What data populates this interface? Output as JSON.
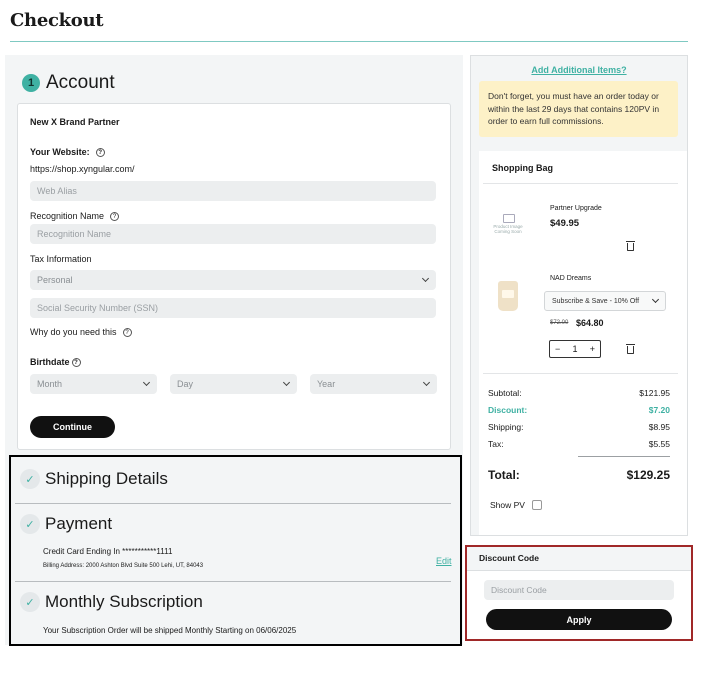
{
  "page": {
    "title": "Checkout"
  },
  "account": {
    "step_number": "1",
    "title": "Account",
    "partner_type": "New X Brand Partner",
    "website_label": "Your Website:",
    "website_prefix": "https://shop.xyngular.com/",
    "web_alias_placeholder": "Web Alias",
    "recognition_label": "Recognition Name",
    "recognition_placeholder": "Recognition Name",
    "tax_label": "Tax Information",
    "tax_selected": "Personal",
    "ssn_placeholder": "Social Security Number (SSN)",
    "why_label": "Why do you need this",
    "birthdate_label": "Birthdate",
    "month_placeholder": "Month",
    "day_placeholder": "Day",
    "year_placeholder": "Year",
    "continue_label": "Continue"
  },
  "sections": {
    "shipping_title": "Shipping Details",
    "payment_title": "Payment",
    "card_text": "Credit Card Ending In ***********1111",
    "billing_text": "Billing Address: 2000 Ashton Blvd Suite 500 Lehi, UT, 84043",
    "edit_label": "Edit",
    "monthly_title": "Monthly Subscription",
    "monthly_text": "Your Subscription Order will be shipped Monthly Starting on 06/06/2025"
  },
  "sidebar": {
    "add_items_label": "Add Additional Items?",
    "notice_text": "Don't forget, you must have an order today or within the last 29 days that contains 120PV in order to earn full commissions.",
    "bag_title": "Shopping Bag",
    "items": [
      {
        "name": "Partner Upgrade",
        "price": "$49.95",
        "image_text": "Product Image Coming Soon"
      },
      {
        "name": "NAD Dreams",
        "option": "Subscribe & Save - 10% Off",
        "old_price": "$72.00",
        "price": "$64.80",
        "quantity": "1"
      }
    ],
    "summary": {
      "subtotal_label": "Subtotal:",
      "subtotal": "$121.95",
      "discount_label": "Discount:",
      "discount": "$7.20",
      "shipping_label": "Shipping:",
      "shipping": "$8.95",
      "tax_label": "Tax:",
      "tax": "$5.55",
      "total_label": "Total:",
      "total": "$129.25"
    },
    "show_pv_label": "Show PV"
  },
  "discount": {
    "title": "Discount Code",
    "placeholder": "Discount Code",
    "apply_label": "Apply"
  },
  "colors": {
    "accent": "#3fb1a3",
    "notice_bg": "#fdf1c7",
    "discount_border": "#a02828"
  }
}
